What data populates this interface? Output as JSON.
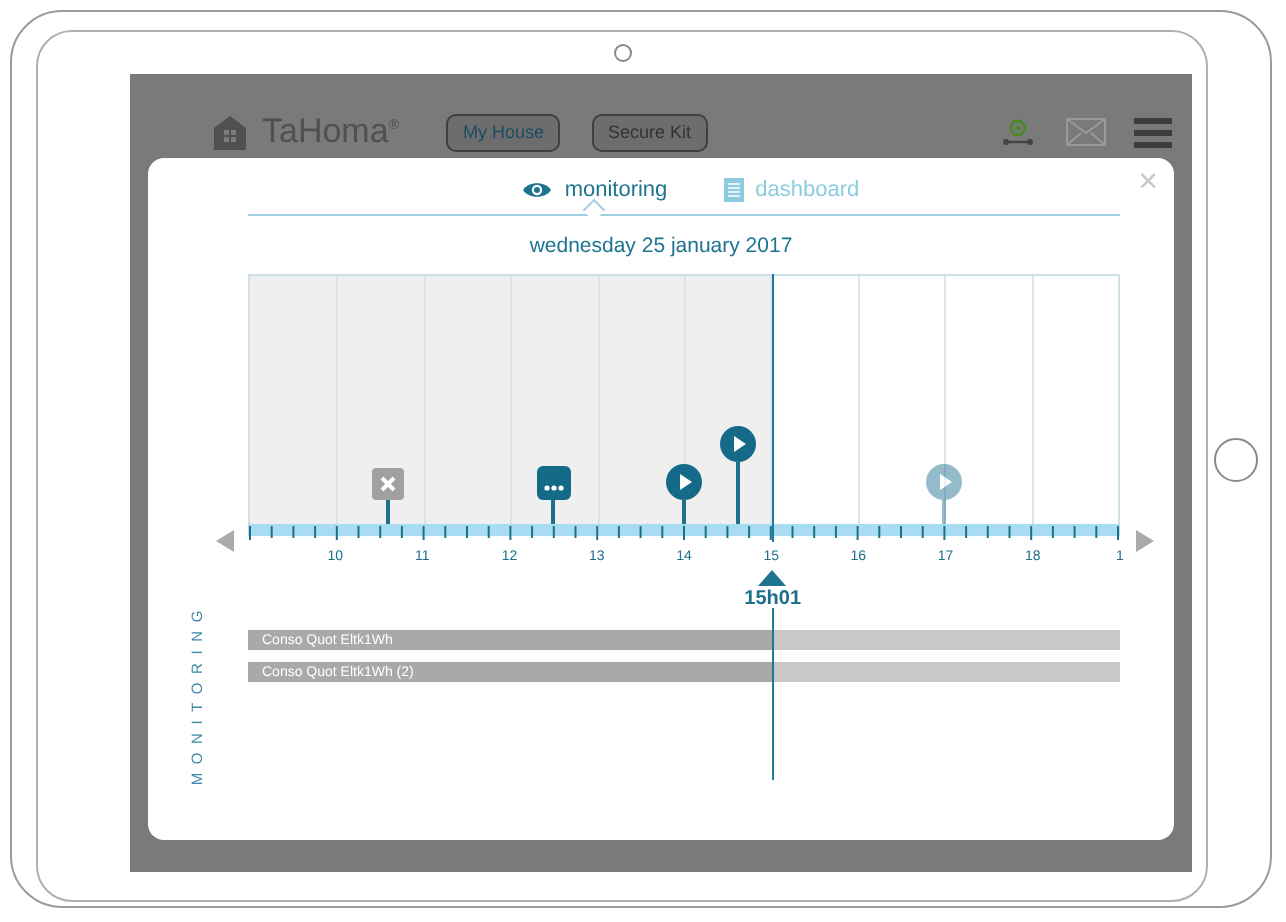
{
  "app": {
    "logo": "TaHoma$^{®}$",
    "houses": [
      {
        "label": "My House",
        "selected": true
      },
      {
        "label": "Secure Kit",
        "selected": false
      }
    ]
  },
  "modal": {
    "close": "×",
    "tabs": [
      {
        "label": "monitoring",
        "kind": "eye",
        "selected": true
      },
      {
        "label": "dashboard",
        "kind": "list",
        "selected": false
      }
    ],
    "date": "wednesday 25 january 2017",
    "timeline": {
      "level": 0.6017,
      "now_label": "15h01",
      "ticks": [
        "10",
        "11",
        "12",
        "13",
        "14",
        "15",
        "16",
        "17",
        "18",
        "1"
      ],
      "events": [
        {
          "kind": "stop",
          "level": 0.16,
          "raised": false
        },
        {
          "kind": "more",
          "level": 0.35,
          "raised": false
        },
        {
          "kind": "play",
          "level": 0.5,
          "raised": false
        },
        {
          "kind": "play",
          "level": 0.5633,
          "raised": true
        },
        {
          "kind": "play",
          "level": 0.8,
          "raised": false
        }
      ]
    },
    "side_label": "MONITORING",
    "bars": [
      {
        "label": "Conso Quot Eltk1Wh"
      },
      {
        "label": "Conso Quot Eltk1Wh (2)"
      }
    ]
  }
}
